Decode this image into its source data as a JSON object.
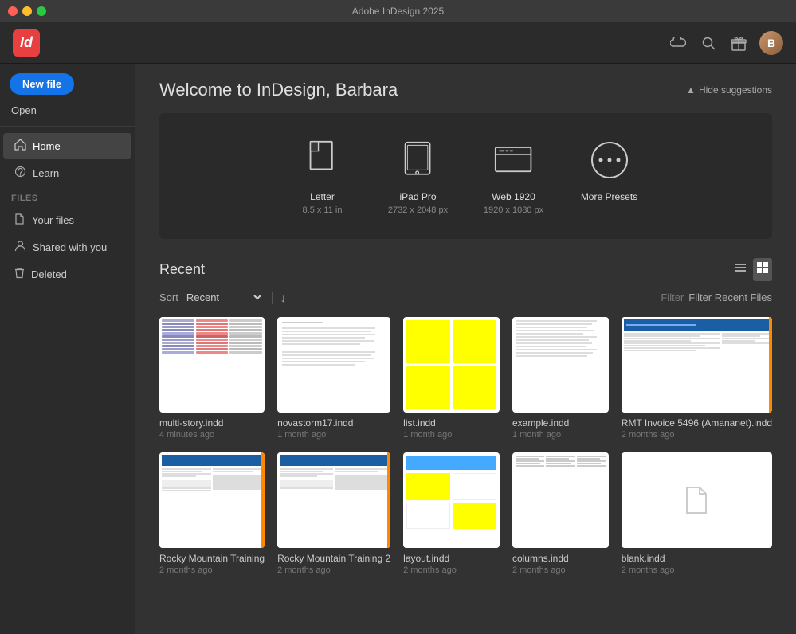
{
  "window": {
    "title": "Adobe InDesign 2025"
  },
  "topnav": {
    "app_logo": "Id",
    "icons": [
      "cloud",
      "search",
      "gift",
      "avatar"
    ]
  },
  "sidebar": {
    "new_file_label": "New file",
    "open_label": "Open",
    "nav_items": [
      {
        "id": "home",
        "label": "Home",
        "icon": "🏠",
        "active": true
      },
      {
        "id": "learn",
        "label": "Learn",
        "icon": "⭐"
      }
    ],
    "files_section_label": "FILES",
    "files_items": [
      {
        "id": "your-files",
        "label": "Your files",
        "icon": "📄"
      },
      {
        "id": "shared-with-you",
        "label": "Shared with you",
        "icon": "👤"
      },
      {
        "id": "deleted",
        "label": "Deleted",
        "icon": "🗑"
      }
    ]
  },
  "content": {
    "welcome_title": "Welcome to InDesign, Barbara",
    "hide_suggestions_label": "Hide suggestions",
    "presets": [
      {
        "id": "letter",
        "label": "Letter",
        "sub": "8.5 x 11 in"
      },
      {
        "id": "ipad-pro",
        "label": "iPad Pro",
        "sub": "2732 x 2048 px"
      },
      {
        "id": "web-1920",
        "label": "Web 1920",
        "sub": "1920 x 1080 px"
      },
      {
        "id": "more-presets",
        "label": "More Presets",
        "sub": ""
      }
    ],
    "recent_section": {
      "title": "Recent",
      "sort_label": "Sort",
      "sort_value": "Recent",
      "filter_label": "Filter",
      "filter_recent_label": "Filter Recent Files"
    },
    "files": [
      {
        "id": "multi-story",
        "name": "multi-story.indd",
        "date": "4 minutes ago",
        "type": "multi-story"
      },
      {
        "id": "novastorm17",
        "name": "novastorm17.indd",
        "date": "1 month ago",
        "type": "document"
      },
      {
        "id": "list",
        "name": "list.indd",
        "date": "1 month ago",
        "type": "list"
      },
      {
        "id": "example",
        "name": "example.indd",
        "date": "1 month ago",
        "type": "example"
      },
      {
        "id": "rmt-invoice",
        "name": "RMT Invoice 5496 (Amananet).indd",
        "date": "2 months ago",
        "type": "rmt"
      },
      {
        "id": "rocky1",
        "name": "Rocky Mountain Training",
        "date": "2 months ago",
        "type": "rocky"
      },
      {
        "id": "rocky2",
        "name": "Rocky Mountain Training 2",
        "date": "2 months ago",
        "type": "rocky2"
      },
      {
        "id": "yellow-layout",
        "name": "layout.indd",
        "date": "2 months ago",
        "type": "yellow-layout"
      },
      {
        "id": "columns",
        "name": "columns.indd",
        "date": "2 months ago",
        "type": "columns"
      },
      {
        "id": "blank",
        "name": "blank.indd",
        "date": "2 months ago",
        "type": "blank"
      }
    ]
  }
}
